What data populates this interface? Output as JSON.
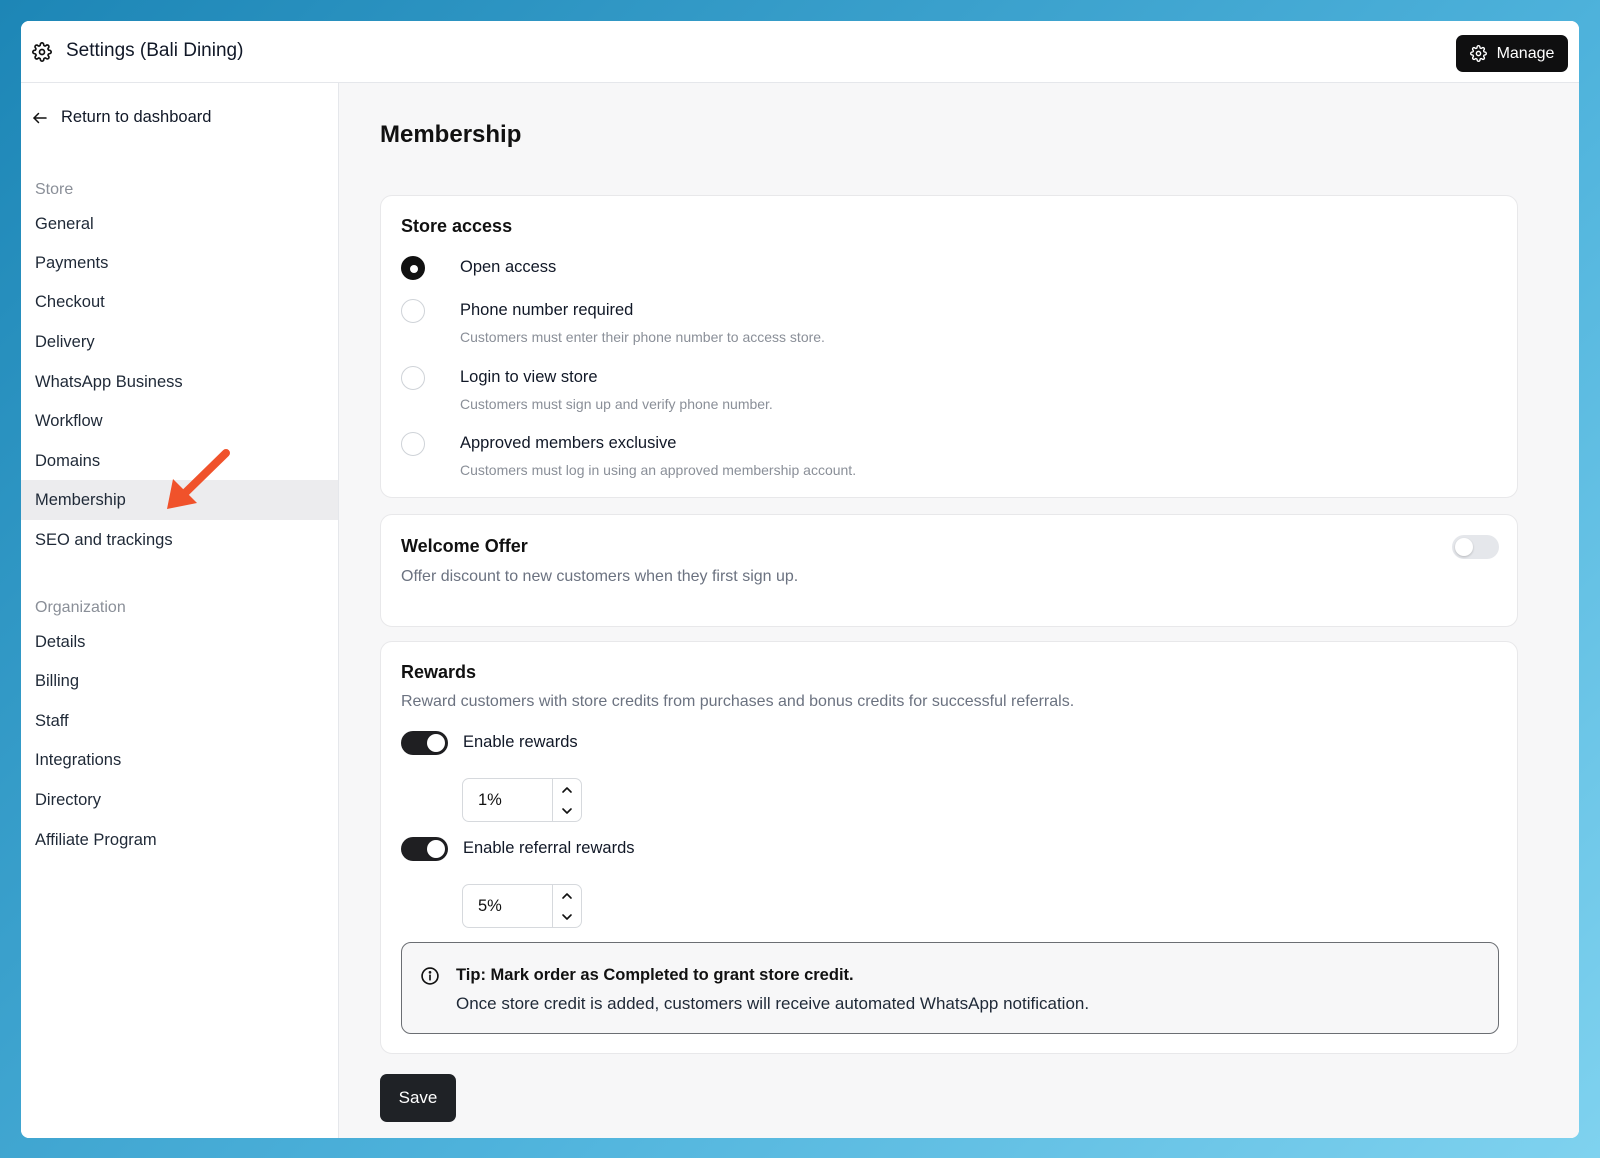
{
  "window": {
    "title": "Settings (Bali Dining)",
    "manage_label": "Manage"
  },
  "sidebar": {
    "return_label": "Return to dashboard",
    "store_section": "Store",
    "store_items": [
      {
        "label": "General"
      },
      {
        "label": "Payments"
      },
      {
        "label": "Checkout"
      },
      {
        "label": "Delivery"
      },
      {
        "label": "WhatsApp Business"
      },
      {
        "label": "Workflow"
      },
      {
        "label": "Domains"
      },
      {
        "label": "Membership",
        "active": true
      },
      {
        "label": "SEO and trackings"
      }
    ],
    "org_section": "Organization",
    "org_items": [
      {
        "label": "Details"
      },
      {
        "label": "Billing"
      },
      {
        "label": "Staff"
      },
      {
        "label": "Integrations"
      },
      {
        "label": "Directory"
      },
      {
        "label": "Affiliate Program"
      }
    ]
  },
  "main": {
    "page_title": "Membership",
    "store_access": {
      "title": "Store access",
      "options": [
        {
          "label": "Open access",
          "desc": "",
          "selected": true
        },
        {
          "label": "Phone number required",
          "desc": "Customers must enter their phone number to access store.",
          "selected": false
        },
        {
          "label": "Login to view store",
          "desc": "Customers must sign up and verify phone number.",
          "selected": false
        },
        {
          "label": "Approved members exclusive",
          "desc": "Customers must log in using an approved membership account.",
          "selected": false
        }
      ]
    },
    "welcome_offer": {
      "title": "Welcome Offer",
      "desc": "Offer discount to new customers when they first sign up.",
      "enabled": false
    },
    "rewards": {
      "title": "Rewards",
      "desc": "Reward customers with store credits from purchases and bonus credits for successful referrals.",
      "enable_rewards_label": "Enable rewards",
      "enable_rewards": true,
      "rewards_value": "1%",
      "enable_referral_label": "Enable referral rewards",
      "enable_referral": true,
      "referral_value": "5%",
      "tip_title": "Tip: Mark order as Completed to grant store credit.",
      "tip_body": "Once store credit is added, customers will receive automated WhatsApp notification."
    },
    "save_label": "Save"
  },
  "colors": {
    "accent": "#111111",
    "annotation_arrow": "#f0522b"
  }
}
